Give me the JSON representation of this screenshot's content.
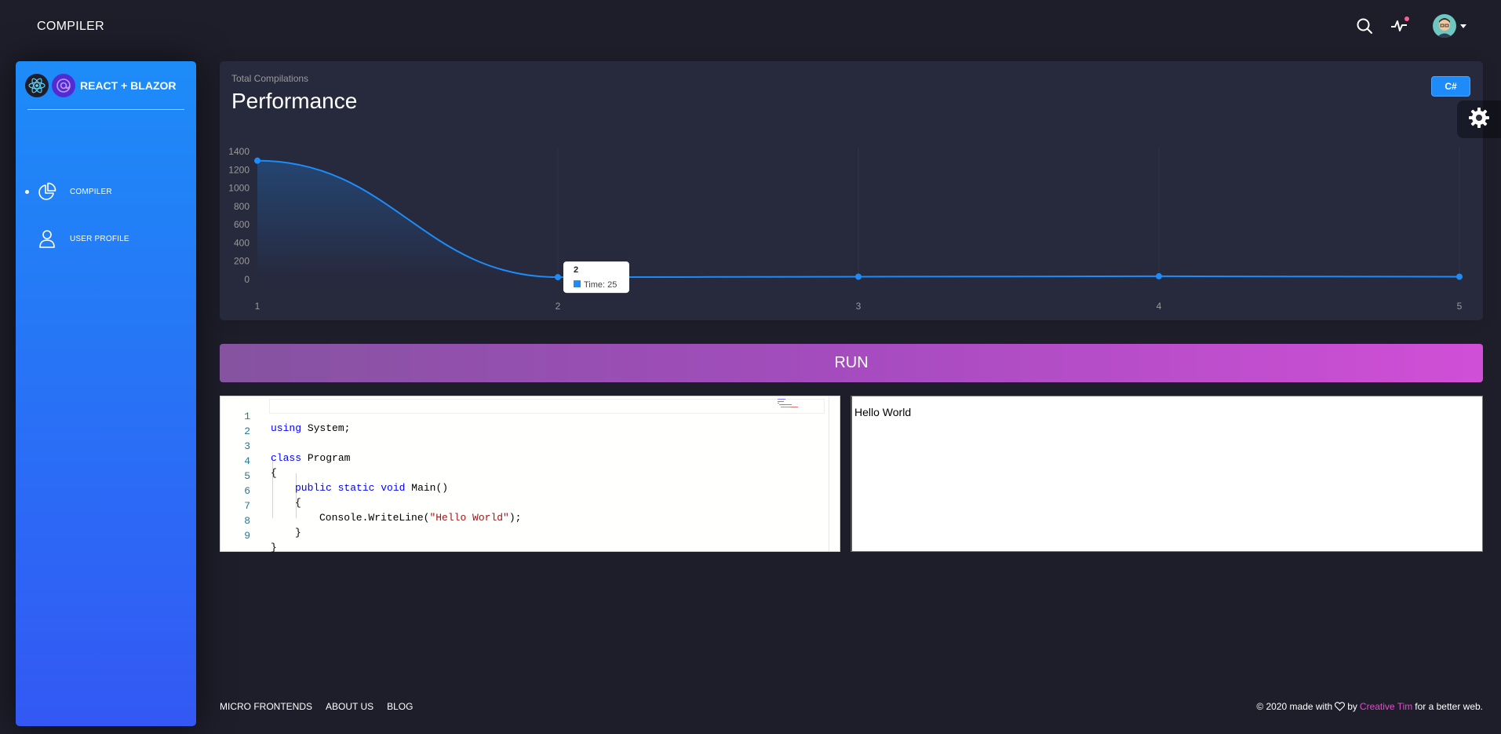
{
  "topbar": {
    "brand": "COMPILER",
    "icons": [
      "search-icon",
      "activity-icon",
      "avatar",
      "chevron-down-icon"
    ]
  },
  "sidebar": {
    "logo_text": "REACT + BLAZOR",
    "items": [
      {
        "label": "COMPILER",
        "icon": "chart-pie-icon",
        "active": true
      },
      {
        "label": "USER PROFILE",
        "icon": "user-icon",
        "active": false
      }
    ]
  },
  "card": {
    "category": "Total Compilations",
    "title": "Performance",
    "language_button": "C#"
  },
  "chart_data": {
    "type": "line",
    "x": [
      1,
      2,
      3,
      4,
      5
    ],
    "series": [
      {
        "values": [
          1300,
          25,
          30,
          35,
          30
        ]
      }
    ],
    "yticks": [
      0,
      200,
      400,
      600,
      800,
      1000,
      1200,
      1400
    ],
    "xticks": [
      "1",
      "2",
      "3",
      "4",
      "5"
    ],
    "ylim": [
      0,
      1400
    ],
    "grid": "vertical",
    "tooltip": {
      "title": "2",
      "label": "Time: 25"
    },
    "color": "#1d8cf8"
  },
  "run_button": "RUN",
  "editor": {
    "lines": [
      {
        "n": "1"
      },
      {
        "n": "2"
      },
      {
        "n": "3"
      },
      {
        "n": "4"
      },
      {
        "n": "5"
      },
      {
        "n": "6"
      },
      {
        "n": "7"
      },
      {
        "n": "8"
      },
      {
        "n": "9"
      }
    ],
    "code": {
      "l1_kw": "using",
      "l1_rest": " System;",
      "l3_kw": "class",
      "l3_rest": " Program",
      "l4": "{",
      "l5_kw1": "public",
      "l5_kw2": "static",
      "l5_kw3": "void",
      "l5_rest": " Main()",
      "l6": "{",
      "l7_pre": "Console.WriteLine(",
      "l7_str": "\"Hello World\"",
      "l7_post": ");",
      "l8": "}",
      "l9": "}"
    }
  },
  "output": {
    "text": "Hello World"
  },
  "footer": {
    "links": [
      "MICRO FRONTENDS",
      "ABOUT US",
      "BLOG"
    ],
    "copyright_pre": "© 2020 made with",
    "copyright_by": "by",
    "author": "Creative Tim",
    "copyright_post": "for a better web."
  },
  "colors": {
    "background": "#1e1e2b",
    "card": "#27293d",
    "sidebar_top": "#1d8cf8",
    "sidebar_bottom": "#3358f4",
    "accent_pink": "#e14eca"
  }
}
